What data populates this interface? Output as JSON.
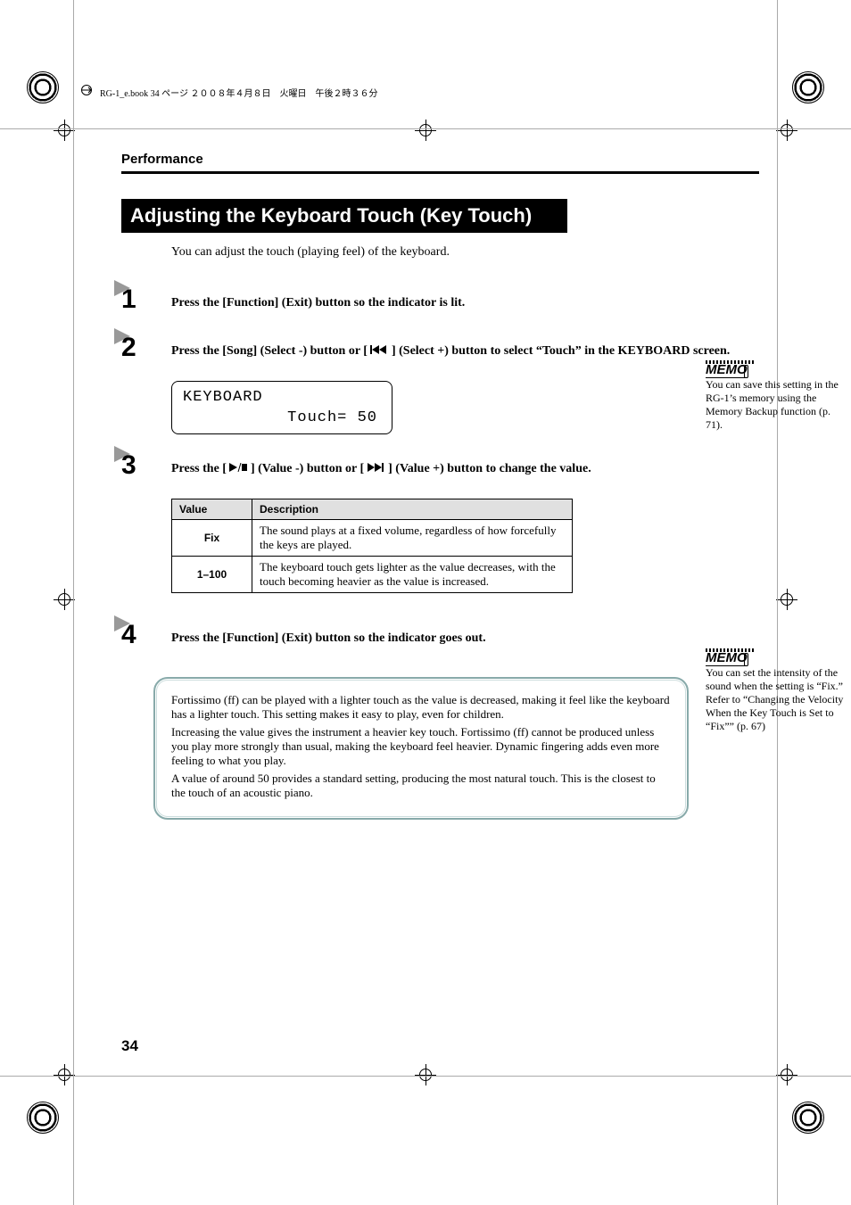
{
  "book_header": {
    "text": "RG-1_e.book 34 ページ ２００８年４月８日　火曜日　午後２時３６分"
  },
  "section_header": "Performance",
  "title": "Adjusting the Keyboard Touch (Key Touch)",
  "intro": "You can adjust the touch (playing feel) of the keyboard.",
  "steps": {
    "s1": {
      "num": "1",
      "text": "Press the [Function] (Exit) button so the indicator is lit."
    },
    "s2": {
      "num": "2",
      "text_a": "Press the [Song] (Select -) button or [ ",
      "text_b": " ] (Select +) button to select “Touch” in the KEYBOARD screen."
    },
    "s3": {
      "num": "3",
      "text_a": "Press the [ ",
      "text_b": " ] (Value -) button or [ ",
      "text_c": " ] (Value +) button to change the value."
    },
    "s4": {
      "num": "4",
      "text": "Press the [Function] (Exit) button so the indicator goes out."
    }
  },
  "screen": {
    "line1": "KEYBOARD",
    "line2": "Touch= 50"
  },
  "table": {
    "headers": {
      "h1": "Value",
      "h2": "Description"
    },
    "rows": [
      {
        "v": "Fix",
        "d": "The sound plays at a fixed volume, regardless of how forcefully the keys are played."
      },
      {
        "v": "1–100",
        "d": "The keyboard touch gets lighter as the value decreases, with the touch becoming heavier as the value is increased."
      }
    ]
  },
  "memo": {
    "label": "MEMO",
    "m1": "You can save this setting in the RG-1’s memory using the Memory Backup function (p. 71).",
    "m2a": "You can set the intensity of the sound when the setting is “Fix.”",
    "m2b": "Refer to “Changing the Velocity When the Key Touch is Set to “Fix”” (p. 67)"
  },
  "infobox": {
    "p1": "Fortissimo (ff) can be played with a lighter touch as the value is decreased, making it feel like the keyboard has a lighter touch. This setting makes it easy to play, even for children.",
    "p2": "Increasing the value gives the instrument a heavier key touch. Fortissimo (ff) cannot be produced unless you play more strongly than usual, making the keyboard feel heavier. Dynamic fingering adds even more feeling to what you play.",
    "p3": "A value of around 50 provides a standard setting, producing the most natural touch. This is the closest to the touch of an acoustic piano."
  },
  "page_num": "34"
}
